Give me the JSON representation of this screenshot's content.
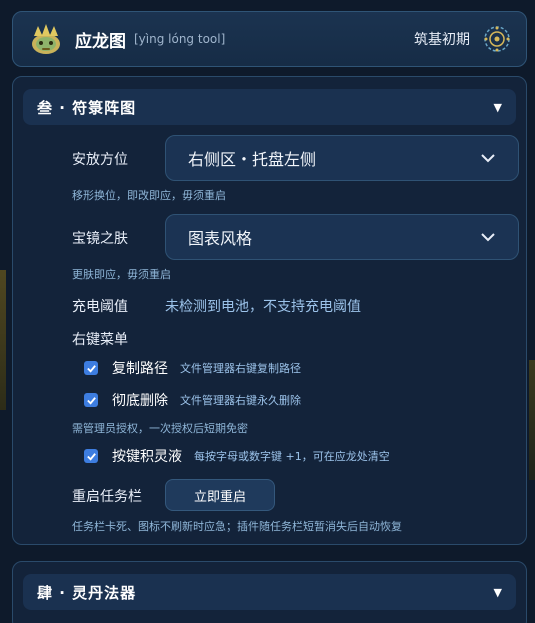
{
  "header": {
    "title": "应龙图",
    "subtitle": "[yìng lóng tool]",
    "level": "筑基初期",
    "logo_icon": "dragon-crown-icon",
    "level_icon": "gear-sigil-icon"
  },
  "section1": {
    "title": "叁 · 符箓阵图",
    "caret": "▼",
    "placement": {
      "label": "安放方位",
      "value": "右侧区・托盘左侧",
      "hint": "移形换位，即改即应，毋须重启"
    },
    "skin": {
      "label": "宝镜之肤",
      "value": "图表风格",
      "hint": "更肤即应，毋须重启"
    },
    "charge": {
      "label": "充电阈值",
      "value": "未检测到电池，不支持充电阈值"
    },
    "context_menu": {
      "label": "右键菜单",
      "copy_path": {
        "label": "复制路径",
        "desc": "文件管理器右键复制路径",
        "checked": true
      },
      "delete": {
        "label": "彻底删除",
        "desc": "文件管理器右键永久删除",
        "checked": true
      },
      "admin_hint": "需管理员授权，一次授权后短期免密",
      "keystroke": {
        "label": "按键积灵液",
        "desc": "每按字母或数字键 +1，可在应龙处清空",
        "checked": true
      }
    },
    "restart": {
      "label": "重启任务栏",
      "button": "立即重启",
      "hint": "任务栏卡死、图标不刷新时应急；插件随任务栏短暂消失后自动恢复"
    }
  },
  "section2": {
    "title": "肆 · 灵丹法器",
    "caret": "▼"
  },
  "colors": {
    "background": "#0e1a2b",
    "panel": "#13233a",
    "accent_blue": "#3d7de0",
    "hint_text": "#8fb6d8"
  }
}
